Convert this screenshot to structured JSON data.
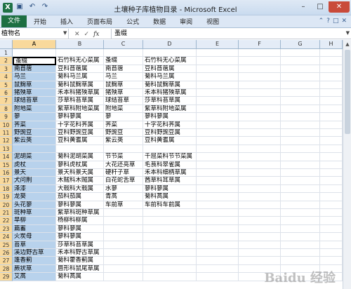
{
  "window": {
    "title": "土壤种子库植物目录 - Microsoft Excel",
    "app_icon": "X",
    "colors": {
      "file_tab": "#1d6f42",
      "selection": "#b8d2ec",
      "header_selected": "#f9d99c",
      "close": "#c94a3a"
    }
  },
  "quick_access": [
    "save-icon",
    "undo-icon",
    "redo-icon"
  ],
  "ribbon": {
    "file_tab": "文件",
    "tabs": [
      "开始",
      "插入",
      "页面布局",
      "公式",
      "数据",
      "审阅",
      "视图"
    ]
  },
  "formula_bar": {
    "name_box": "植物名",
    "fx": "fx",
    "value": "蚤缀"
  },
  "sheet": {
    "columns": [
      "A",
      "B",
      "C",
      "D",
      "E",
      "F",
      "G",
      "H"
    ],
    "rows": [
      {
        "n": "1",
        "a": "",
        "b": "",
        "c": "",
        "d": ""
      },
      {
        "n": "2",
        "a": "蚤缀",
        "b": "石竹科无心菜属",
        "c": "蚤缀",
        "d": "石竹科无心菜属"
      },
      {
        "n": "3",
        "a": "南苜蓿",
        "b": "豆科苜蓿属",
        "c": "南苜蓿",
        "d": "豆科苜蓿属"
      },
      {
        "n": "4",
        "a": "马兰",
        "b": "菊科马兰属",
        "c": "马兰",
        "d": "菊科马兰属"
      },
      {
        "n": "5",
        "a": "鼠麴草",
        "b": "菊科鼠麴草属",
        "c": "鼠麴草",
        "d": "菊科鼠麴草属"
      },
      {
        "n": "6",
        "a": "猪殃草",
        "b": "禾本科猪殃草属",
        "c": "猪殃草",
        "d": "禾本科猪殃草属"
      },
      {
        "n": "7",
        "a": "球结苔草",
        "b": "莎草科苔草属",
        "c": "球结苔草",
        "d": "莎草科苔草属"
      },
      {
        "n": "8",
        "a": "附地菜",
        "b": "紫草科附地菜属",
        "c": "附地菜",
        "d": "紫草科附地菜属"
      },
      {
        "n": "9",
        "a": "蓼",
        "b": "蓼科蓼属",
        "c": "蓼",
        "d": "蓼科蓼属"
      },
      {
        "n": "10",
        "a": "荠菜",
        "b": "十字花科荠属",
        "c": "荠菜",
        "d": "十字花科荠属"
      },
      {
        "n": "11",
        "a": "野豌豆",
        "b": "豆科野豌豆属",
        "c": "野豌豆",
        "d": "豆科野豌豆属"
      },
      {
        "n": "12",
        "a": "紫云英",
        "b": "豆科黄耆属",
        "c": "紫云英",
        "d": "豆科黄耆属"
      },
      {
        "n": "13",
        "a": "",
        "b": "",
        "c": "",
        "d": ""
      },
      {
        "n": "14",
        "a": "泥胡菜",
        "b": "菊科泥胡菜属",
        "c": "节节菜",
        "d": "千屈菜科节节菜属"
      },
      {
        "n": "15",
        "a": "虎杖",
        "b": "蓼科虎杖属",
        "c": "大花还亮草",
        "d": "毛茛科翠雀属"
      },
      {
        "n": "16",
        "a": "景天",
        "b": "景天科景天属",
        "c": "硬秆子草",
        "d": "禾本科细柄草属"
      },
      {
        "n": "17",
        "a": "犬问荆",
        "b": "木贼科木贼属",
        "c": "白花蛇舌草",
        "d": "茜草科耳草属"
      },
      {
        "n": "18",
        "a": "泽漆",
        "b": "大戟科大戟属",
        "c": "水蓼",
        "d": "蓼科蓼属"
      },
      {
        "n": "19",
        "a": "龙葵",
        "b": "茄科茄属",
        "c": "青蒿",
        "d": "菊科蒿属"
      },
      {
        "n": "20",
        "a": "头花蓼",
        "b": "蓼科蓼属",
        "c": "车前草",
        "d": "车前科车前属"
      },
      {
        "n": "21",
        "a": "斑种草",
        "b": "紫草科斑种草属",
        "c": "",
        "d": ""
      },
      {
        "n": "22",
        "a": "旱柳",
        "b": "杨柳科柳属",
        "c": "",
        "d": ""
      },
      {
        "n": "23",
        "a": "萹蓄",
        "b": "蓼科蓼属",
        "c": "",
        "d": ""
      },
      {
        "n": "24",
        "a": "火炭母",
        "b": "蓼科蓼属",
        "c": "",
        "d": ""
      },
      {
        "n": "25",
        "a": "苔草",
        "b": "莎草科苔草属",
        "c": "",
        "d": ""
      },
      {
        "n": "26",
        "a": "溪边野古草",
        "b": "禾本科野古草属",
        "c": "",
        "d": ""
      },
      {
        "n": "27",
        "a": "蓬香蓟",
        "b": "菊科藿香蓟属",
        "c": "",
        "d": ""
      },
      {
        "n": "28",
        "a": "蕨状草",
        "b": "唇形科鼠尾草属",
        "c": "",
        "d": ""
      },
      {
        "n": "29",
        "a": "艾蒿",
        "b": "菊科蒿属",
        "c": "",
        "d": ""
      }
    ]
  }
}
